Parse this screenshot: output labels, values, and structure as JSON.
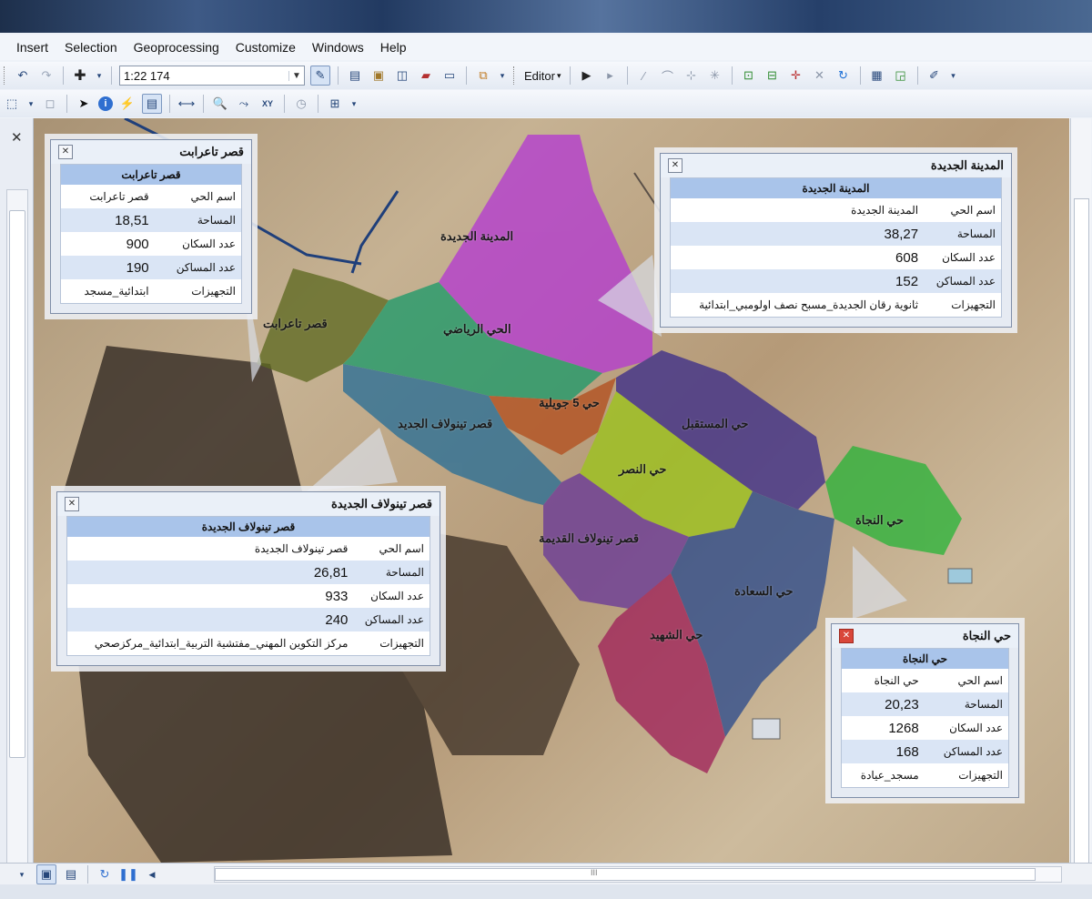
{
  "menu": [
    "Insert",
    "Selection",
    "Geoprocessing",
    "Customize",
    "Windows",
    "Help"
  ],
  "toolbar": {
    "scale": "1:22 174",
    "editor_label": "Editor"
  },
  "map_labels": [
    {
      "text": "المدينة الجديدة"
    },
    {
      "text": "قصر تاعرابت"
    },
    {
      "text": "الحي الرياضي"
    },
    {
      "text": "حي 5 جويلية"
    },
    {
      "text": "قصر تينولاف الجديد"
    },
    {
      "text": "حي المستقبل"
    },
    {
      "text": "حي النصر"
    },
    {
      "text": "حي النجاة"
    },
    {
      "text": "قصر تينولاف القديمة"
    },
    {
      "text": "حي السعادة"
    },
    {
      "text": "حي الشهيد"
    }
  ],
  "popups": [
    {
      "title": "قصر تاعرابت",
      "header": "قصر تاعرابت",
      "close_red": false,
      "rows": [
        {
          "label": "اسم الحي",
          "value": "قصر تاعرابت",
          "num": false
        },
        {
          "label": "المساحة",
          "value": "18,51",
          "num": true
        },
        {
          "label": "عدد السكان",
          "value": "900",
          "num": true
        },
        {
          "label": "عدد المساكن",
          "value": "190",
          "num": true
        },
        {
          "label": "التجهيزات",
          "value": "ابتدائية_مسجد",
          "num": false
        }
      ]
    },
    {
      "title": "المدينة الجديدة",
      "header": "المدينة الجديدة",
      "close_red": false,
      "rows": [
        {
          "label": "اسم الحي",
          "value": "المدينة الجديدة",
          "num": false
        },
        {
          "label": "المساحة",
          "value": "38,27",
          "num": true
        },
        {
          "label": "عدد السكان",
          "value": "608",
          "num": true
        },
        {
          "label": "عدد المساكن",
          "value": "152",
          "num": true
        },
        {
          "label": "التجهيزات",
          "value": "ثانوية رقان الجديدة_مسبح نصف اولومبي_ابتدائية",
          "num": false
        }
      ]
    },
    {
      "title": "قصر تينولاف الجديدة",
      "header": "قصر تينولاف الجديدة",
      "close_red": false,
      "rows": [
        {
          "label": "اسم الحي",
          "value": "قصر تينولاف الجديدة",
          "num": false
        },
        {
          "label": "المساحة",
          "value": "26,81",
          "num": true
        },
        {
          "label": "عدد السكان",
          "value": "933",
          "num": true
        },
        {
          "label": "عدد المساكن",
          "value": "240",
          "num": true
        },
        {
          "label": "التجهيزات",
          "value": "مركز التكوين المهني_مفتشية التربية_ابتدائية_مركزصحي",
          "num": false
        }
      ]
    },
    {
      "title": "حي النجاة",
      "header": "حي النجاة",
      "close_red": true,
      "rows": [
        {
          "label": "اسم الحي",
          "value": "حي النجاة",
          "num": false
        },
        {
          "label": "المساحة",
          "value": "20,23",
          "num": true
        },
        {
          "label": "عدد السكان",
          "value": "1268",
          "num": true
        },
        {
          "label": "عدد المساكن",
          "value": "168",
          "num": true
        },
        {
          "label": "التجهيزات",
          "value": "مسجد_عيادة",
          "num": false
        }
      ]
    }
  ],
  "bottombar": {
    "hscroll_mark": "III"
  }
}
